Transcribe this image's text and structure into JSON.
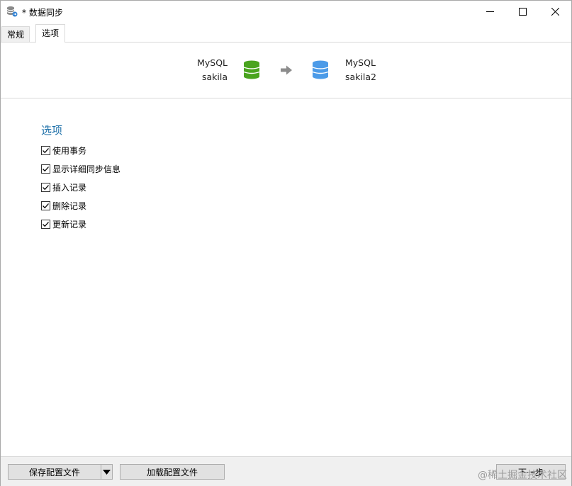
{
  "window": {
    "title": "* 数据同步"
  },
  "tabs": [
    {
      "label": "常规",
      "active": false
    },
    {
      "label": "选项",
      "active": true
    }
  ],
  "sync": {
    "source": {
      "type": "MySQL",
      "name": "sakila",
      "color": "#4aa41f"
    },
    "target": {
      "type": "MySQL",
      "name": "sakila2",
      "color": "#4c9be8"
    }
  },
  "options": {
    "title": "选项",
    "items": [
      {
        "label": "使用事务",
        "checked": true
      },
      {
        "label": "显示详细同步信息",
        "checked": true
      },
      {
        "label": "插入记录",
        "checked": true
      },
      {
        "label": "删除记录",
        "checked": true
      },
      {
        "label": "更新记录",
        "checked": true
      }
    ]
  },
  "footer": {
    "save_profile_label": "保存配置文件",
    "load_profile_label": "加载配置文件",
    "next_label": "下一步",
    "watermark": "@稀土掘金技术社区"
  },
  "colors": {
    "accent_title": "#1c6fa8",
    "source_db": "#4aa41f",
    "target_db": "#4c9be8"
  }
}
